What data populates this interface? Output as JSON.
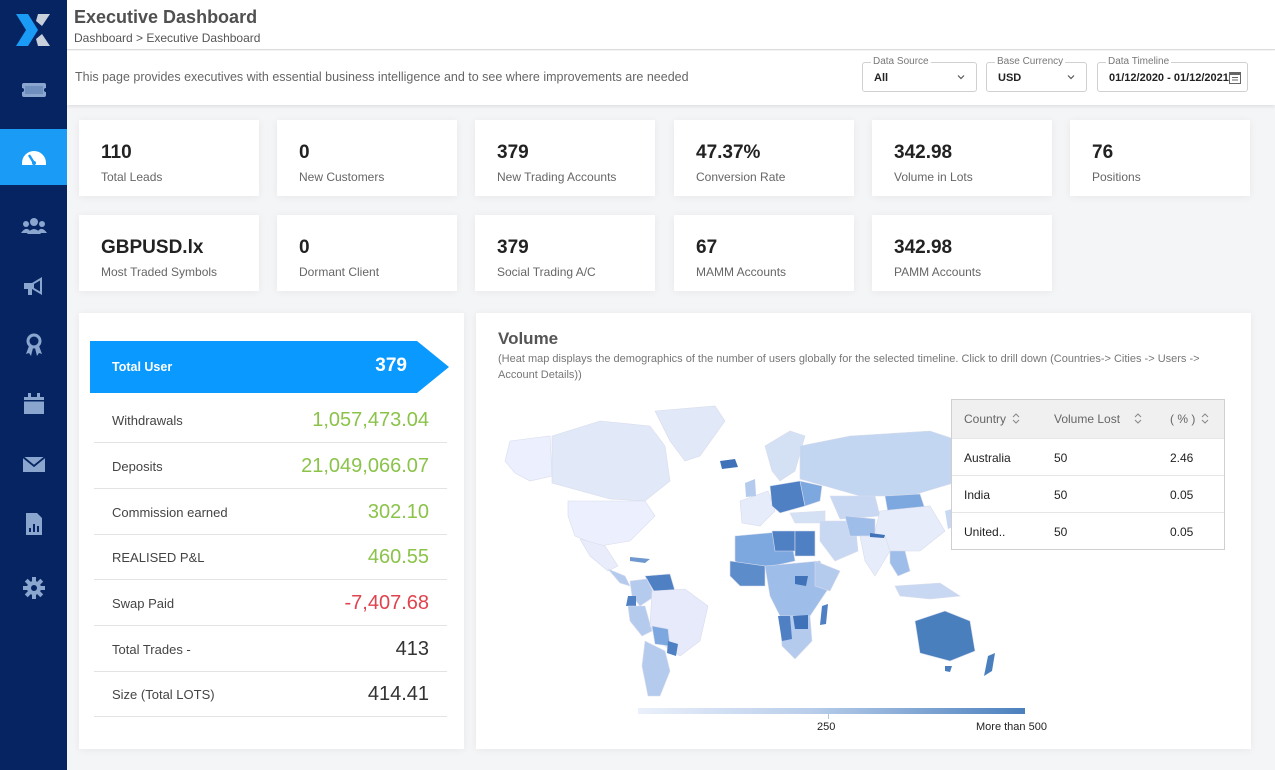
{
  "header": {
    "title": "Executive Dashboard",
    "breadcrumb": "Dashboard > Executive Dashboard",
    "description": "This page provides executives with essential business intelligence and to see where improvements are needed"
  },
  "sidebar": {
    "items": [
      {
        "icon": "ticket-icon",
        "active": false
      },
      {
        "icon": "dashboard-gauge-icon",
        "active": true
      },
      {
        "icon": "users-icon",
        "active": false
      },
      {
        "icon": "megaphone-icon",
        "active": false
      },
      {
        "icon": "award-icon",
        "active": false
      },
      {
        "icon": "calendar-icon",
        "active": false
      },
      {
        "icon": "mail-icon",
        "active": false
      },
      {
        "icon": "report-icon",
        "active": false
      },
      {
        "icon": "settings-icon",
        "active": false
      }
    ]
  },
  "filters": {
    "data_source": {
      "label": "Data Source",
      "value": "All"
    },
    "base_currency": {
      "label": "Base Currency",
      "value": "USD"
    },
    "data_timeline": {
      "label": "Data Timeline",
      "value": "01/12/2020 - 01/12/2021"
    }
  },
  "stats": [
    {
      "value": "110",
      "label": "Total Leads"
    },
    {
      "value": "0",
      "label": "New Customers"
    },
    {
      "value": "379",
      "label": "New Trading Accounts"
    },
    {
      "value": "47.37%",
      "label": "Conversion Rate"
    },
    {
      "value": "342.98",
      "label": "Volume in Lots"
    },
    {
      "value": "76",
      "label": "Positions"
    },
    {
      "value": "GBPUSD.lx",
      "label": "Most Traded Symbols"
    },
    {
      "value": "0",
      "label": "Dormant Client"
    },
    {
      "value": "379",
      "label": "Social Trading A/C"
    },
    {
      "value": "67",
      "label": "MAMM Accounts"
    },
    {
      "value": "342.98",
      "label": "PAMM Accounts"
    }
  ],
  "summary": {
    "total_user": {
      "label": "Total User",
      "value": "379"
    },
    "rows": [
      {
        "label": "Withdrawals",
        "value": "1,057,473.04",
        "tone": "positive"
      },
      {
        "label": "Deposits",
        "value": "21,049,066.07",
        "tone": "positive"
      },
      {
        "label": "Commission earned",
        "value": "302.10",
        "tone": "positive"
      },
      {
        "label": "REALISED P&L",
        "value": "460.55",
        "tone": "positive"
      },
      {
        "label": "Swap Paid",
        "value": "-7,407.68",
        "tone": "negative"
      },
      {
        "label": "Total Trades -",
        "value": "413",
        "tone": "neutral"
      },
      {
        "label": "Size (Total LOTS)",
        "value": "414.41",
        "tone": "neutral"
      }
    ]
  },
  "volume": {
    "title": "Volume",
    "description": "(Heat map displays the demographics of the number of users globally for the selected timeline. Click to drill down (Countries-> Cities -> Users -> Account Details))",
    "table": {
      "headers": [
        "Country",
        "Volume Lost",
        "( % )"
      ],
      "rows": [
        [
          "Australia",
          "50",
          "2.46"
        ],
        [
          "India",
          "50",
          "0.05"
        ],
        [
          "United..",
          "50",
          "0.05"
        ]
      ]
    },
    "legend": {
      "mid_label": "250",
      "max_label": "More than 500",
      "colors": [
        "#eaf0fb",
        "#4b80bd"
      ]
    }
  },
  "colors": {
    "sidebar_bg": "#062462",
    "accent": "#1a9bf5",
    "positive": "#8bc34a",
    "negative": "#e0434d"
  }
}
